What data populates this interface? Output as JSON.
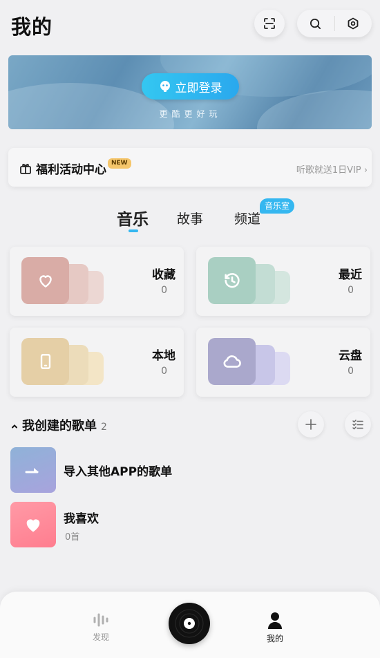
{
  "header": {
    "title": "我的",
    "scan_icon": "scan-icon",
    "search_icon": "search-icon",
    "settings_icon": "settings-icon"
  },
  "banner": {
    "login_label": "立即登录",
    "subtitle": "更酷更好玩"
  },
  "welfare": {
    "title": "福利活动中心",
    "badge": "NEW",
    "promo": "听歌就送1日VIP"
  },
  "tabs": [
    {
      "label": "音乐",
      "active": true
    },
    {
      "label": "故事",
      "active": false
    },
    {
      "label": "频道",
      "active": false,
      "badge": "音乐室"
    }
  ],
  "categories": [
    {
      "label": "收藏",
      "count": "0",
      "icon": "heart-icon",
      "color": "#d9aca6"
    },
    {
      "label": "最近",
      "count": "0",
      "icon": "clock-icon",
      "color": "#a9cfc2"
    },
    {
      "label": "本地",
      "count": "0",
      "icon": "phone-icon",
      "color": "#e5cfa6"
    },
    {
      "label": "云盘",
      "count": "0",
      "icon": "cloud-icon",
      "color": "#aaa8cc"
    }
  ],
  "playlists_section": {
    "title": "我创建的歌单",
    "count": "2",
    "items": [
      {
        "title": "导入其他APP的歌单",
        "subtitle": "",
        "icon": "import-icon"
      },
      {
        "title": "我喜欢",
        "subtitle": "0首",
        "icon": "heart-icon"
      }
    ]
  },
  "bottom_nav": {
    "discover_label": "发现",
    "mine_label": "我的"
  },
  "colors": {
    "accent": "#35b7f0",
    "background": "#f0f0f2"
  }
}
